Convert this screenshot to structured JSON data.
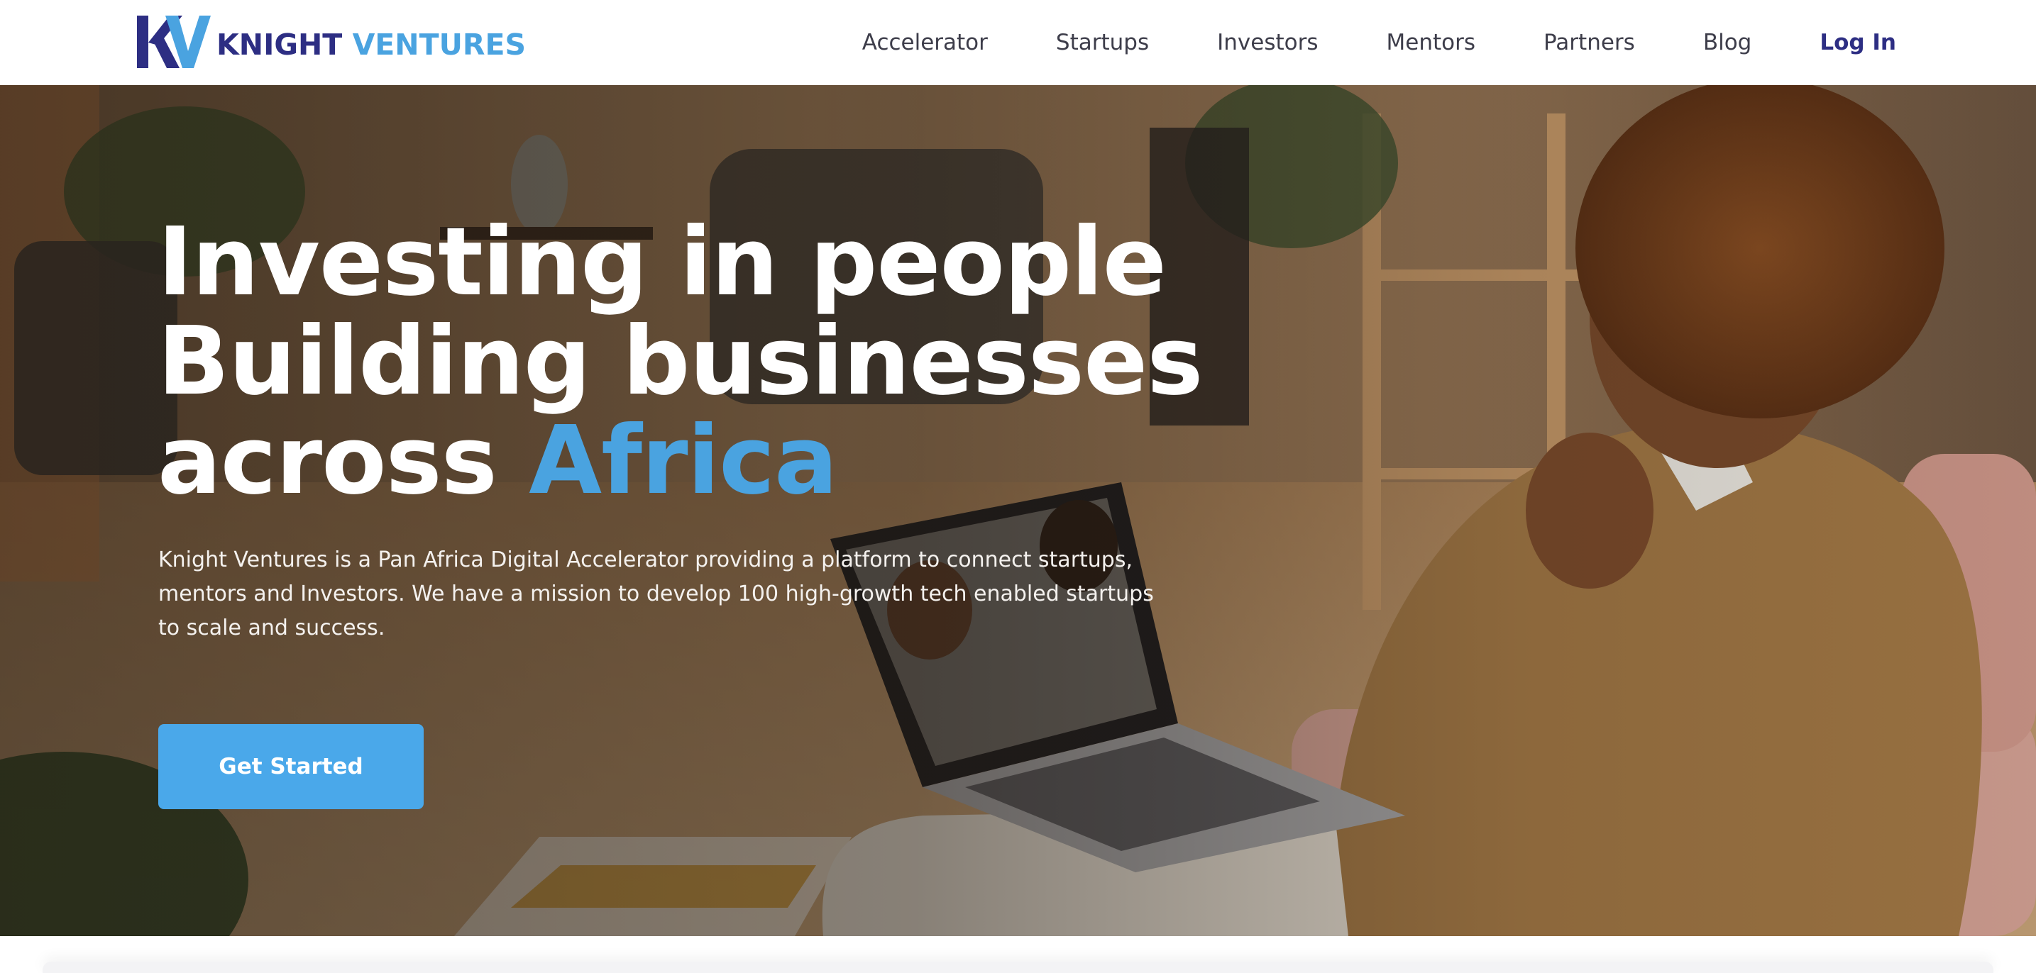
{
  "brand": {
    "name_part1": "KNIGHT",
    "name_part2": "VENTURES",
    "mark_letters": "KV",
    "primary_color": "#2d2e83",
    "accent_color": "#4aa3e0"
  },
  "nav": {
    "items": [
      {
        "label": "Accelerator"
      },
      {
        "label": "Startups"
      },
      {
        "label": "Investors"
      },
      {
        "label": "Mentors"
      },
      {
        "label": "Partners"
      },
      {
        "label": "Blog"
      }
    ],
    "login_label": "Log In"
  },
  "hero": {
    "headline_line1": "Investing in people",
    "headline_line2": "Building businesses",
    "headline_line3_prefix": "across ",
    "headline_line3_accent": "Africa",
    "description": "Knight Ventures is a Pan Africa Digital Accelerator providing a platform to connect startups, mentors and Investors. We have a mission to develop 100 high-growth tech enabled startups to scale and success.",
    "cta_label": "Get Started",
    "cta_color": "#4aa8ea",
    "background_image": "photo-person-on-video-call-with-laptop"
  }
}
